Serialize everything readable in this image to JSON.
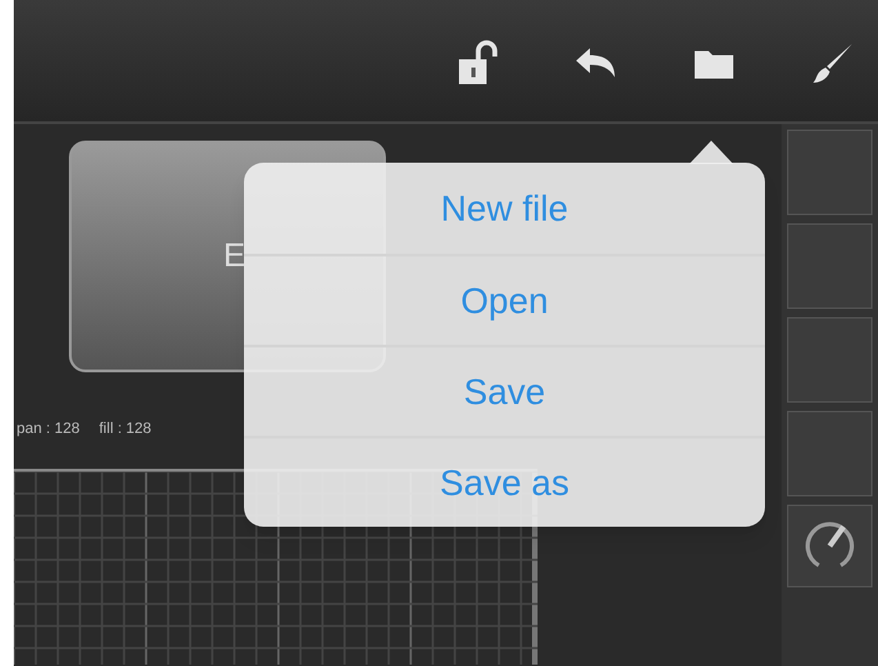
{
  "toolbar": {
    "buttons": [
      {
        "kind": "lock"
      },
      {
        "kind": "undo"
      },
      {
        "kind": "folder"
      },
      {
        "kind": "brush"
      }
    ]
  },
  "preset": {
    "name": "E"
  },
  "readouts": [
    "pan : 128",
    "fill : 128"
  ],
  "menu": {
    "items": [
      "New file",
      "Open",
      "Save",
      "Save as"
    ]
  }
}
